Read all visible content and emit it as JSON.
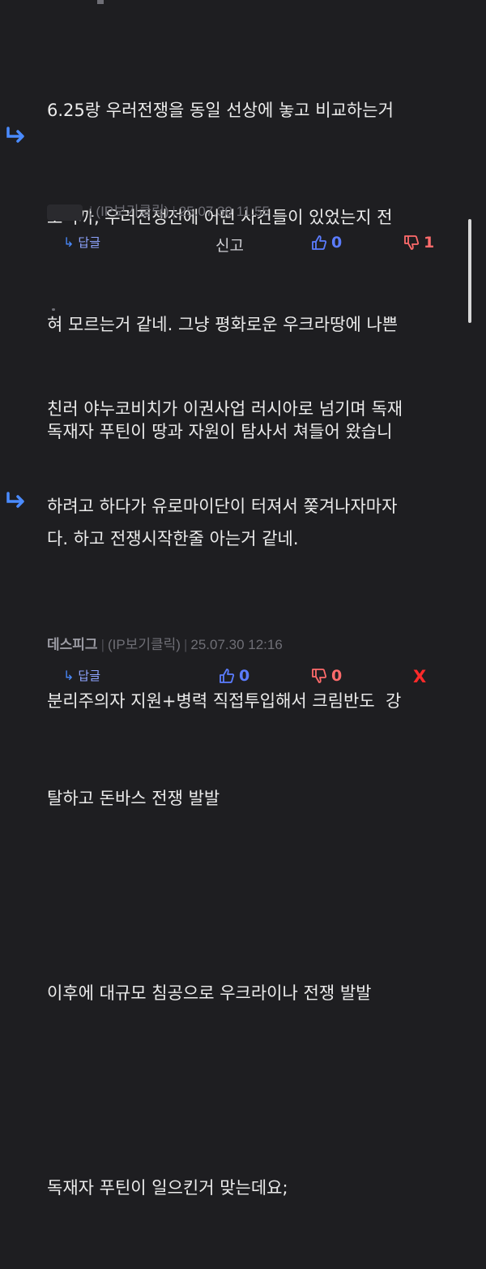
{
  "comments": [
    {
      "lines": [
        "6.25랑 우러전쟁을 동일 선상에 놓고 비교하는거",
        "보니까, 우러전쟁전에 어떤 사건들이 있었는지 전",
        "혀 모르는거 같네. 그냥 평화로운 우크라땅에 나쁜",
        "독재자 푸틴이 땅과 자원이 탐사서 쳐들어 왔습니",
        "다. 하고 전쟁시작한줄 아는거 같네."
      ],
      "author": "",
      "ip": "(IP보기클릭)",
      "time": "25.07.30 11:55",
      "reply_label": "답글",
      "report_label": "신고",
      "upvotes": "0",
      "downvotes": "1"
    },
    {
      "lines": [
        "친러 야누코비치가 이권사업 러시아로 넘기며 독재",
        "하려고 하다가 유로마이단이 터져서 쫒겨나자마자",
        "",
        "분리주의자 지원+병력 직접투입해서 크림반도  강",
        "탈하고 돈바스 전쟁 발발",
        "",
        "이후에 대규모 침공으로 우크라이나 전쟁 발발",
        "",
        "독재자 푸틴이 일으킨거 맞는데요;"
      ],
      "author": "데스피그",
      "ip": "(IP보기클릭)",
      "time": "25.07.30 12:16",
      "reply_label": "답글",
      "upvotes": "0",
      "downvotes": "0",
      "delete_label": "X"
    }
  ],
  "colors": {
    "background": "#1e1e21",
    "upvote": "#5b7cff",
    "downvote": "#ff6b6b",
    "reply_arrow": "#4a8bff",
    "delete": "#ff2a2a"
  },
  "icons": {
    "reply_arrow": "reply-arrow-icon",
    "thumb_up": "thumbs-up-icon",
    "thumb_down": "thumbs-down-icon"
  }
}
